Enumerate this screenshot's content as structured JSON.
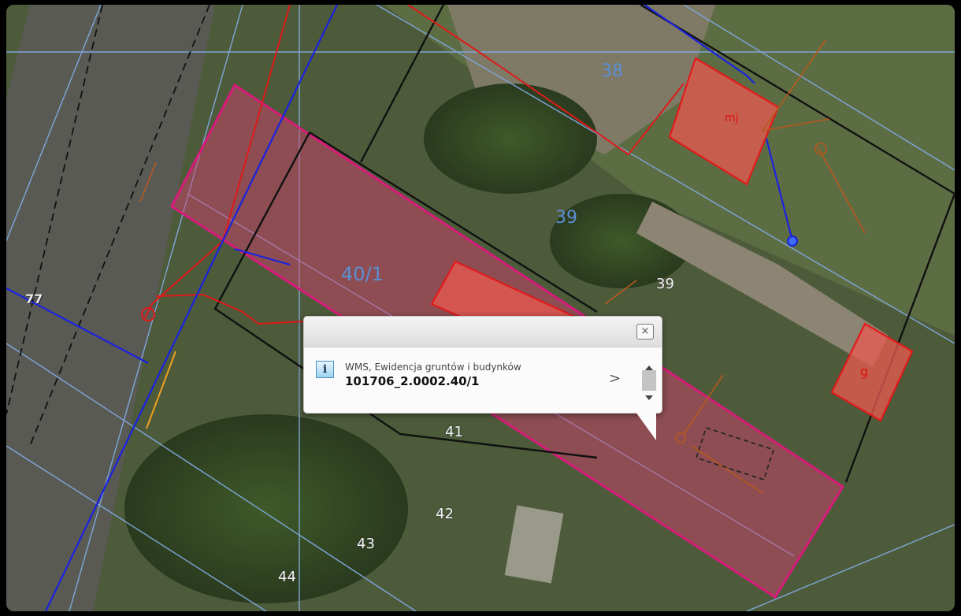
{
  "map": {
    "parcel_labels": [
      {
        "id": "38",
        "text": "38"
      },
      {
        "id": "39a",
        "text": "39"
      },
      {
        "id": "39b",
        "text": "39"
      },
      {
        "id": "40_1",
        "text": "40/1"
      },
      {
        "id": "41",
        "text": "41"
      },
      {
        "id": "42",
        "text": "42"
      },
      {
        "id": "43",
        "text": "43"
      },
      {
        "id": "44",
        "text": "44"
      },
      {
        "id": "77",
        "text": "77"
      }
    ],
    "building_labels": {
      "mj": "mj",
      "g": "g"
    },
    "highlight_color": "#d81b7a",
    "boundary_color": "#111111",
    "utility_colors": {
      "water": "#1a22e0",
      "gas": "#e01a1a",
      "power": "#b8581c"
    }
  },
  "popup": {
    "source": "WMS, Ewidencja gruntów i budynków",
    "feature_id": "101706_2.0002.40/1",
    "close_label": "×",
    "info_icon": "i",
    "next_label": ">"
  }
}
